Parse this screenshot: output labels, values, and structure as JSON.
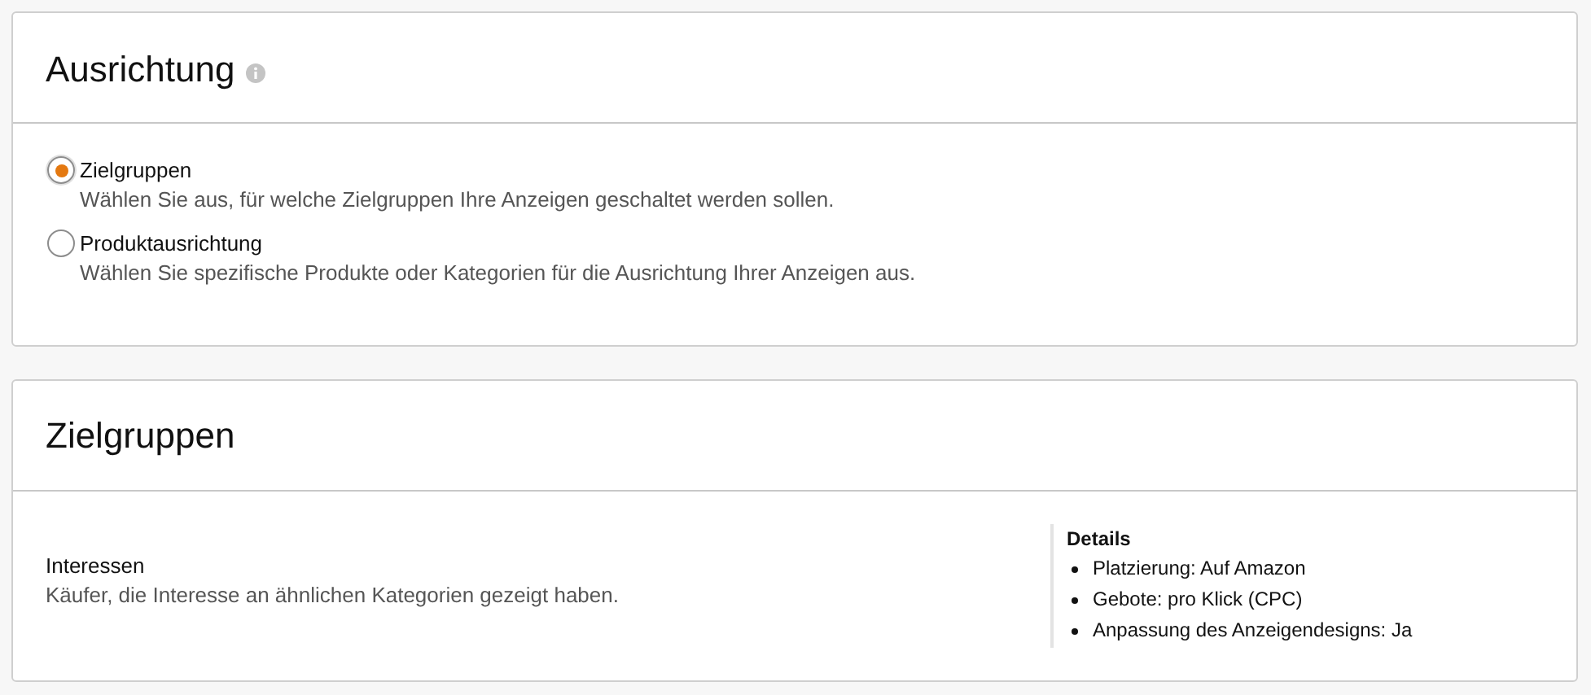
{
  "targeting_card": {
    "title": "Ausrichtung",
    "options": [
      {
        "label": "Zielgruppen",
        "description": "Wählen Sie aus, für welche Zielgruppen Ihre Anzeigen geschaltet werden sollen.",
        "selected": true
      },
      {
        "label": "Produktausrichtung",
        "description": "Wählen Sie spezifische Produkte oder Kategorien für die Ausrichtung Ihrer Anzeigen aus.",
        "selected": false
      }
    ]
  },
  "audiences_card": {
    "title": "Zielgruppen",
    "audience": {
      "name": "Interessen",
      "description": "Käufer, die Interesse an ähnlichen Kategorien gezeigt haben."
    },
    "details": {
      "title": "Details",
      "items": [
        "Platzierung: Auf Amazon",
        "Gebote: pro Klick (CPC)",
        "Anpassung des Anzeigendesigns: Ja"
      ]
    }
  }
}
